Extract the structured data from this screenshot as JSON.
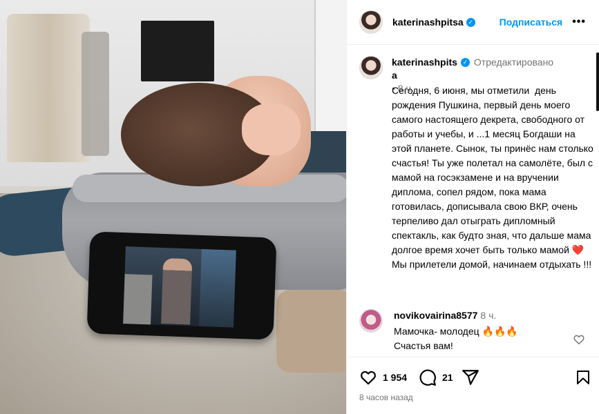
{
  "post": {
    "author": "katerinashpitsa",
    "author_split": "katerinashpitsa",
    "follow_label": "Подписаться",
    "more_label": "•••",
    "verified_mark": "✓",
    "edited_label": "Отредактировано",
    "age_short": "• 8 ч.",
    "caption": "Сегодня, 6 июня, мы отметили  день рождения Пушкина, первый день моего самого настоящего декрета, свободного от работы и учебы, и ...1 месяц Богдаши на этой планете. Сынок, ты принёс нам столько счастья! Ты уже полетал на самолёте, был с мамой на госэкзамене и на вручении диплома, сопел рядом, пока мама готовилась, дописывала свою ВКР, очень терпеливо дал отыграть дипломный спектакль, как будто зная, что дальше мама долгое время хочет быть только мамой",
    "caption_heart": "❤️",
    "caption_tail": " Мы прилетели домой, начинаем отдыхать !!!",
    "likes": "1 954",
    "comments_count": "21",
    "time_ago": "8 часов назад"
  },
  "comment": {
    "author": "novikovairina8577",
    "age": "8 ч.",
    "text": "Мамочка- молодец 🔥🔥🔥\nСчастья вам!"
  },
  "colors": {
    "accent": "#0095f6",
    "muted": "#737373",
    "heart": "#e0245e"
  },
  "icons": [
    "verified-icon",
    "more-options-icon",
    "like-icon",
    "comment-icon",
    "share-icon",
    "save-icon",
    "comment-like-icon"
  ]
}
